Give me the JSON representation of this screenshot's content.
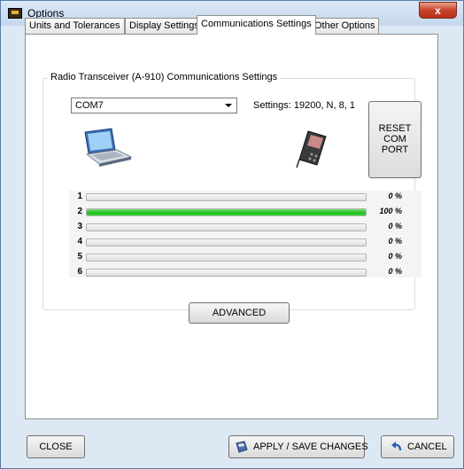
{
  "window": {
    "title": "Options",
    "close_glyph": "x"
  },
  "tabs": [
    {
      "label": "Units and Tolerances"
    },
    {
      "label": "Display Settings"
    },
    {
      "label": "Communications Settings",
      "active": true
    },
    {
      "label": "Other Options"
    }
  ],
  "comm": {
    "group_title": "Radio Transceiver (A-910) Communications Settings",
    "port": "COM7",
    "settings": "Settings: 19200, N, 8, 1",
    "reset_label": [
      "RESET",
      "COM",
      "PORT"
    ],
    "laptop_icon": "laptop-icon",
    "device_icon": "handheld-device-icon",
    "channels": [
      {
        "num": "1",
        "value": 0,
        "pct": "0 %"
      },
      {
        "num": "2",
        "value": 100,
        "pct": "100 %"
      },
      {
        "num": "3",
        "value": 0,
        "pct": "0 %"
      },
      {
        "num": "4",
        "value": 0,
        "pct": "0 %"
      },
      {
        "num": "5",
        "value": 0,
        "pct": "0 %"
      },
      {
        "num": "6",
        "value": 0,
        "pct": "0 %"
      }
    ],
    "advanced_label": "ADVANCED"
  },
  "footer": {
    "close_label": "CLOSE",
    "apply_label": "APPLY / SAVE CHANGES",
    "cancel_label": "CANCEL"
  },
  "colors": {
    "progress_fill": "#22c022",
    "close_button": "#c7422a"
  }
}
